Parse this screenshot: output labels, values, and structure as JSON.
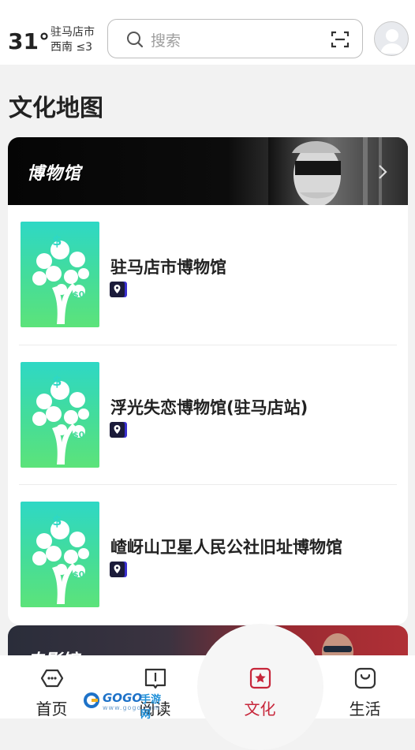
{
  "weather": {
    "temperature": "31°",
    "city": "驻马店市",
    "wind": "西南 ≤3"
  },
  "search": {
    "placeholder": "搜索"
  },
  "page": {
    "title": "文化地图"
  },
  "museum_section": {
    "title": "博物馆",
    "items": [
      {
        "name": "驻马店市博物馆"
      },
      {
        "name": "浮光失恋博物馆(驻马店站)"
      },
      {
        "name": "嵖岈山卫星人民公社旧址博物馆"
      }
    ]
  },
  "cinema_section": {
    "title": "电影馆"
  },
  "tabbar": {
    "active": "文化",
    "tabs": [
      {
        "label": "首页",
        "icon": "home-icon"
      },
      {
        "label": "阅读",
        "icon": "book-icon"
      },
      {
        "label": "文化",
        "icon": "culture-star-icon"
      },
      {
        "label": "生活",
        "icon": "life-bag-icon"
      }
    ],
    "active_color": "#c7263a"
  },
  "watermark": {
    "brand": "GOGO",
    "suffix": "手游网",
    "url": "www.gogo.com"
  },
  "colors": {
    "thumb_gradient_top": "#2ed8c5",
    "thumb_gradient_bottom": "#5ce37a",
    "pin_badge": "#1b1b3a"
  }
}
